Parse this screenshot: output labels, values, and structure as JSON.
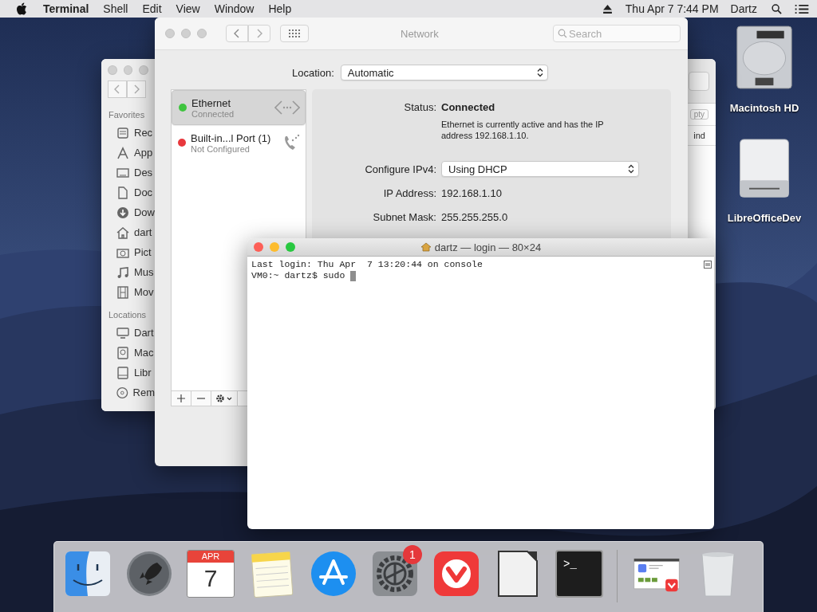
{
  "menu_bar": {
    "app": "Terminal",
    "items": [
      "Shell",
      "Edit",
      "View",
      "Window",
      "Help"
    ],
    "clock": "Thu Apr 7  7:44 PM",
    "user": "Dartz"
  },
  "desktop_icons": [
    {
      "label": "Macintosh HD",
      "kind": "hd"
    },
    {
      "label": "LibreOfficeDev",
      "kind": "drive"
    }
  ],
  "finder": {
    "sidebar": [
      {
        "heading": "Favorites",
        "items": [
          {
            "label": "Rec",
            "kind": "recents"
          },
          {
            "label": "App",
            "kind": "apps"
          },
          {
            "label": "Des",
            "kind": "desktop"
          },
          {
            "label": "Doc",
            "kind": "documents"
          },
          {
            "label": "Dow",
            "kind": "downloads"
          },
          {
            "label": "dart",
            "kind": "home"
          },
          {
            "label": "Pict",
            "kind": "pictures"
          },
          {
            "label": "Mus",
            "kind": "music"
          },
          {
            "label": "Mov",
            "kind": "movies"
          }
        ]
      },
      {
        "heading": "Locations",
        "items": [
          {
            "label": "Dart",
            "kind": "computer"
          },
          {
            "label": "Mac",
            "kind": "disk"
          },
          {
            "label": "Libr",
            "kind": "drive"
          },
          {
            "label": "Rem",
            "kind": "disc"
          }
        ]
      }
    ],
    "button_text": "pty",
    "column_3": "ind"
  },
  "network": {
    "title": "Network",
    "search": {
      "placeholder": "Search"
    },
    "location_label": "Location:",
    "location": "Automatic",
    "services": [
      {
        "name": "Ethernet",
        "status": "Connected",
        "color": "#3ec43e",
        "selected": true,
        "kind": "ethernet"
      },
      {
        "name": "Built-in...l Port (1)",
        "status": "Not Configured",
        "color": "#e8383d",
        "selected": false,
        "kind": "phone"
      }
    ],
    "status_label": "Status:",
    "status": "Connected",
    "status_note": "Ethernet is currently active and has the IP address 192.168.1.10.",
    "fields": [
      {
        "label": "Configure IPv4:",
        "value": "Using DHCP",
        "kind": "select"
      },
      {
        "label": "IP Address:",
        "value": "192.168.1.10",
        "kind": "text"
      },
      {
        "label": "Subnet Mask:",
        "value": "255.255.255.0",
        "kind": "text"
      }
    ]
  },
  "terminal": {
    "title": "dartz — login — 80×24",
    "lines": [
      "Last login: Thu Apr  7 13:20:44 on console",
      "VM0:~ dartz$ sudo "
    ]
  },
  "dock": {
    "items": [
      {
        "kind": "finder"
      },
      {
        "kind": "launchpad"
      },
      {
        "kind": "calendar",
        "month": "APR",
        "day": "7"
      },
      {
        "kind": "notes"
      },
      {
        "kind": "appstore"
      },
      {
        "kind": "settings",
        "badge": "1"
      },
      {
        "kind": "vivaldi"
      },
      {
        "kind": "libreoffice"
      },
      {
        "kind": "terminal",
        "prompt": ">_"
      },
      {
        "kind": "separator"
      },
      {
        "kind": "thumbnail"
      },
      {
        "kind": "trash"
      }
    ]
  }
}
